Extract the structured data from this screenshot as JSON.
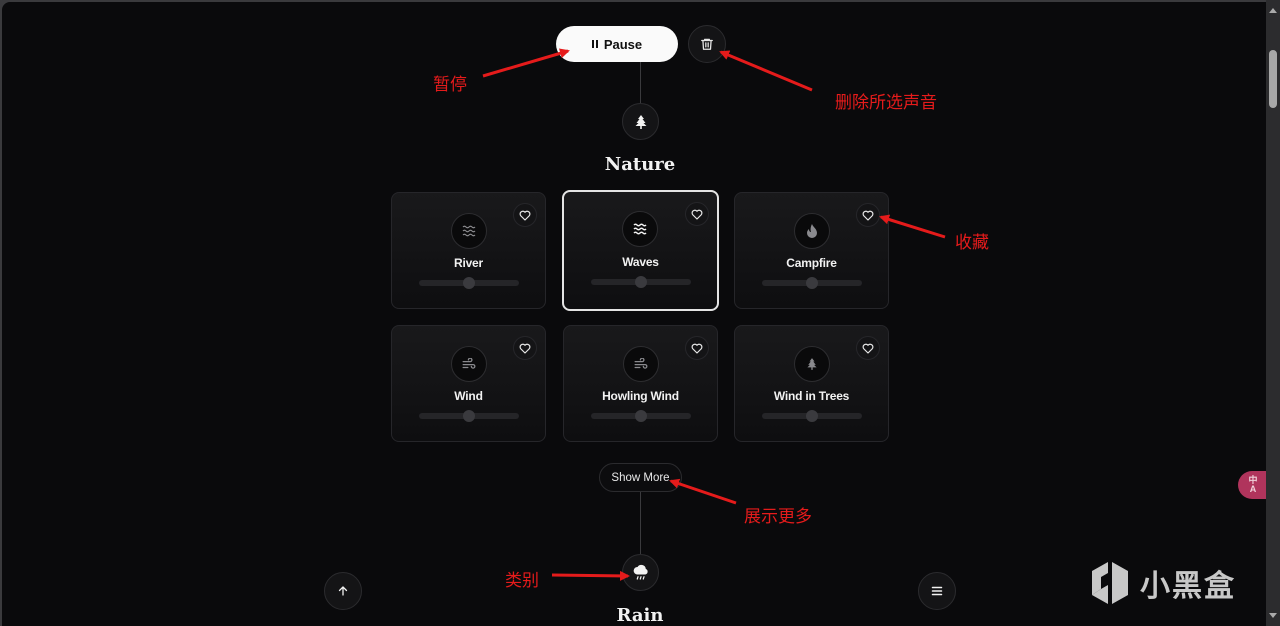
{
  "controls": {
    "pause_label": "Pause",
    "pause_icon": "pause-icon",
    "trash_icon": "trash-icon"
  },
  "categories": [
    {
      "title": "Nature",
      "icon": "tree-icon",
      "show_more_label": "Show More",
      "sounds": [
        {
          "name": "River",
          "icon": "water-waves-icon",
          "selected": false,
          "volume": 0.5,
          "favorite": false
        },
        {
          "name": "Waves",
          "icon": "waves-icon",
          "selected": true,
          "volume": 0.5,
          "favorite": false
        },
        {
          "name": "Campfire",
          "icon": "fire-icon",
          "selected": false,
          "volume": 0.5,
          "favorite": false
        },
        {
          "name": "Wind",
          "icon": "wind-icon",
          "selected": false,
          "volume": 0.5,
          "favorite": false
        },
        {
          "name": "Howling Wind",
          "icon": "wind-icon",
          "selected": false,
          "volume": 0.5,
          "favorite": false
        },
        {
          "name": "Wind in Trees",
          "icon": "tree-icon",
          "selected": false,
          "volume": 0.5,
          "favorite": false
        }
      ]
    },
    {
      "title": "Rain",
      "icon": "cloud-rain-icon"
    }
  ],
  "floating": {
    "scroll_top_icon": "arrow-up-icon",
    "menu_icon": "menu-icon"
  },
  "annotations": {
    "pause": "暂停",
    "delete_selected": "删除所选声音",
    "favorite": "收藏",
    "show_more": "展示更多",
    "category": "类别"
  },
  "overlay": {
    "translate_badge": "中\nA",
    "watermark_text": "小黑盒"
  },
  "colors": {
    "background": "#0a0a0c",
    "annotation": "#e51b1b",
    "translate_badge": "#b0345c"
  }
}
